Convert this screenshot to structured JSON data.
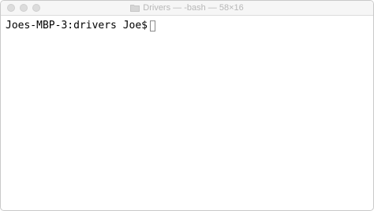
{
  "window": {
    "title": "Drivers — -bash — 58×16"
  },
  "terminal": {
    "prompt": "Joes-MBP-3:drivers Joe$"
  },
  "icons": {
    "title_icon": "folder-icon",
    "cursor": "cursor-block"
  }
}
